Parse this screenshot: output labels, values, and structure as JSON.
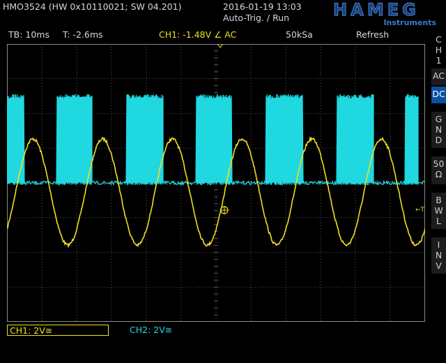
{
  "header": {
    "model": "HMO3524 (HW 0x10110021; SW 04.201)",
    "datetime": "2016-01-19 13:03",
    "trigger_mode": "Auto-Trig. / Run",
    "brand": "HAMEG",
    "brand_sub": "Instruments"
  },
  "status": {
    "timebase": "TB: 10ms",
    "time_offset": "T: -2.6ms",
    "trigger": "CH1: -1.48V ∠ AC",
    "sample_rate": "50kSa",
    "acquisition": "Refresh"
  },
  "sidebar": {
    "channel": [
      "C",
      "H",
      "1"
    ],
    "buttons": [
      {
        "name": "ac",
        "label": [
          "AC"
        ],
        "active": false
      },
      {
        "name": "dc",
        "label": [
          "DC"
        ],
        "active": true
      },
      {
        "name": "gnd",
        "label": [
          "G",
          "N",
          "D"
        ],
        "active": false
      },
      {
        "name": "50ohm",
        "label": [
          "50",
          "Ω"
        ],
        "active": false
      },
      {
        "name": "bwl",
        "label": [
          "B",
          "W",
          "L"
        ],
        "active": false
      },
      {
        "name": "inv",
        "label": [
          "I",
          "N",
          "V"
        ],
        "active": false
      }
    ]
  },
  "channels": {
    "ch1": "CH1: 2V≅",
    "ch2": "CH2: 2V≅"
  },
  "colors": {
    "ch1": "#f0e020",
    "ch2": "#20d8e0",
    "grid": "#6e6e6e",
    "accent": "#0a50a0"
  },
  "markers": {
    "ch1_ground": "1",
    "trigger_level": "←T"
  }
}
